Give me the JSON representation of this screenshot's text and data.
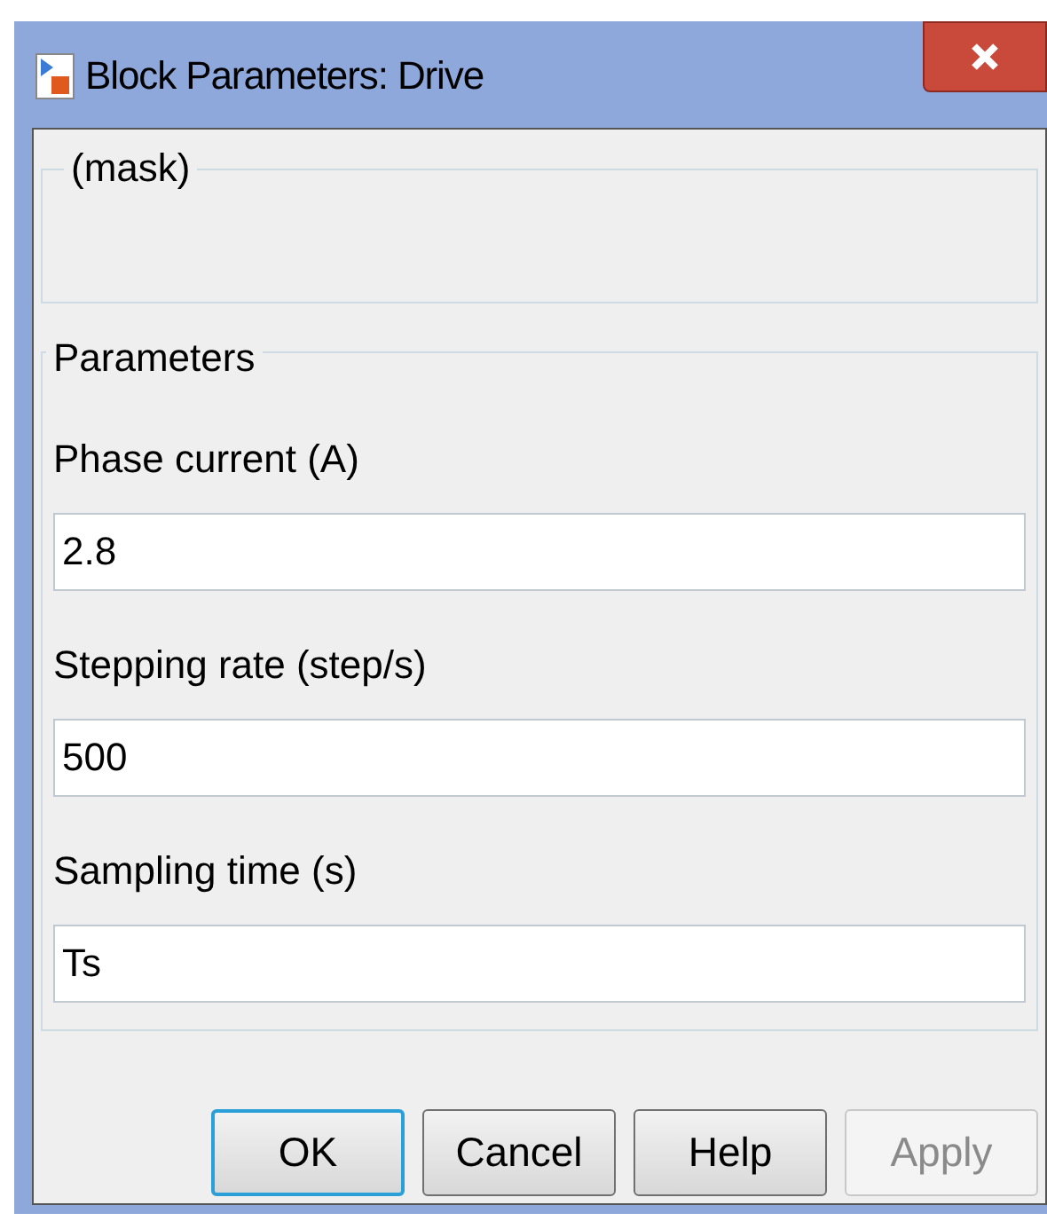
{
  "window": {
    "title": "Block Parameters: Drive"
  },
  "mask": {
    "label": "(mask)"
  },
  "parameters": {
    "label": "Parameters",
    "fields": [
      {
        "label": "Phase current (A)",
        "value": "2.8"
      },
      {
        "label": "Stepping rate (step/s)",
        "value": "500"
      },
      {
        "label": "Sampling time (s)",
        "value": "Ts"
      }
    ]
  },
  "buttons": [
    {
      "label": "OK",
      "default": true,
      "disabled": false
    },
    {
      "label": "Cancel",
      "default": false,
      "disabled": false
    },
    {
      "label": "Help",
      "default": false,
      "disabled": false
    },
    {
      "label": "Apply",
      "default": false,
      "disabled": true
    }
  ]
}
